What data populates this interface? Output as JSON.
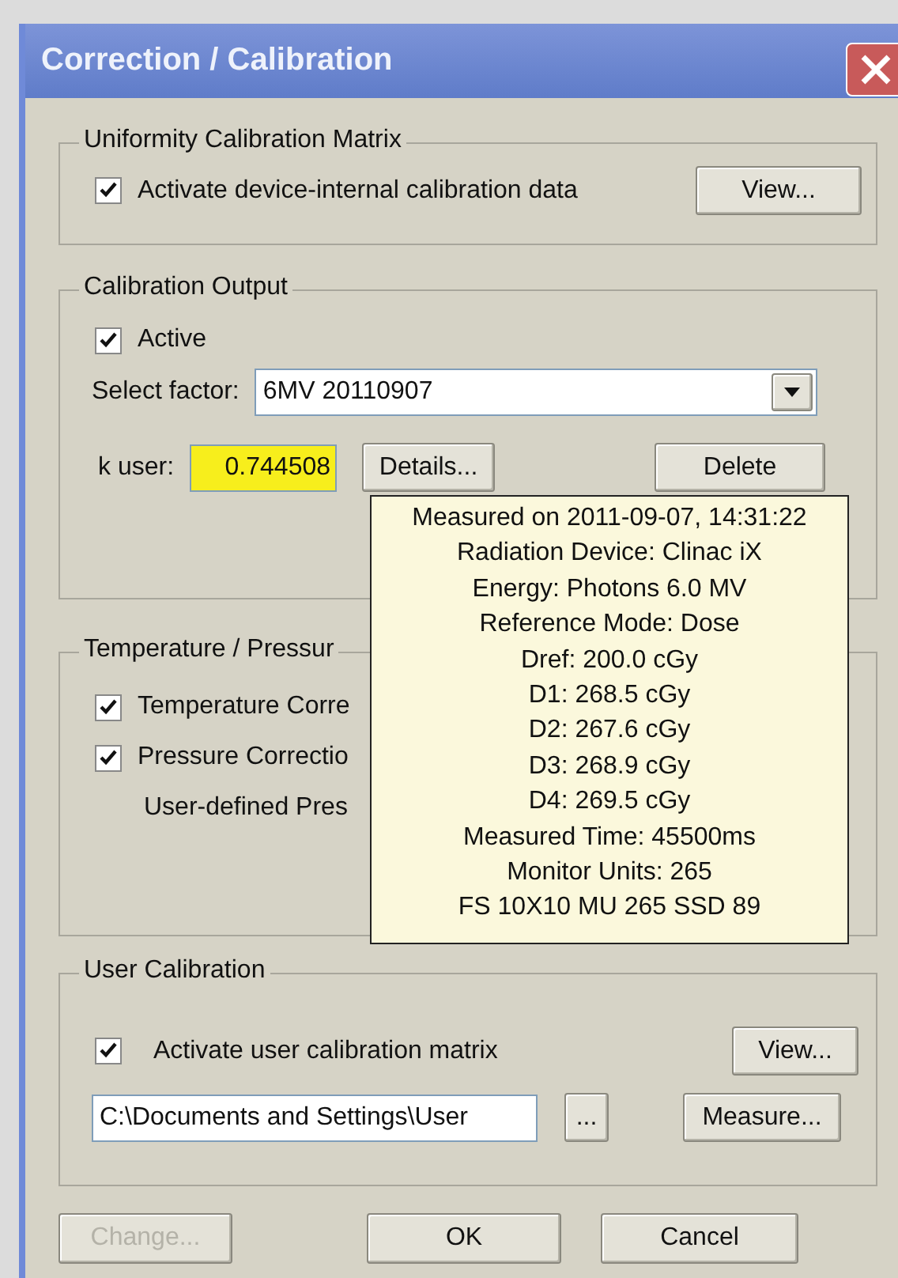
{
  "window": {
    "title": "Correction / Calibration"
  },
  "uniformity": {
    "legend": "Uniformity Calibration Matrix",
    "checkbox": {
      "label": "Activate device-internal calibration data",
      "checked": true
    },
    "view_button": "View..."
  },
  "calibration_output": {
    "legend": "Calibration Output",
    "active": {
      "label": "Active",
      "checked": true
    },
    "select_label": "Select factor:",
    "select_value": "6MV 20110907",
    "k_user_label": "k user:",
    "k_user_value": "0.744508",
    "k_user_highlighted": true,
    "details_button": "Details...",
    "delete_button": "Delete"
  },
  "temperature_pressure": {
    "legend": "Temperature / Pressur",
    "checkboxes": [
      {
        "label": "Temperature Corre",
        "checked": true
      },
      {
        "label": "Pressure Correctio",
        "checked": true
      }
    ],
    "note": "User-defined Pres"
  },
  "user_calibration": {
    "legend": "User Calibration",
    "checkbox": {
      "label": "Activate user calibration matrix",
      "checked": true
    },
    "view_button": "View...",
    "path_value": "C:\\Documents and Settings\\User",
    "browse_button": "...",
    "measure_button": "Measure..."
  },
  "tooltip": {
    "lines": [
      "Measured on 2011-09-07, 14:31:22",
      "Radiation Device: Clinac iX",
      "Energy: Photons 6.0 MV",
      "Reference Mode: Dose",
      "Dref: 200.0 cGy",
      "D1: 268.5 cGy",
      "D2: 267.6 cGy",
      "D3: 268.9 cGy",
      "D4: 269.5 cGy",
      "Measured Time: 45500ms",
      "Monitor Units: 265",
      "FS 10X10 MU 265 SSD 89"
    ]
  },
  "buttons": [
    {
      "label": "Change...",
      "disabled": true
    },
    {
      "label": "OK",
      "disabled": false
    },
    {
      "label": "Cancel",
      "disabled": false
    }
  ]
}
